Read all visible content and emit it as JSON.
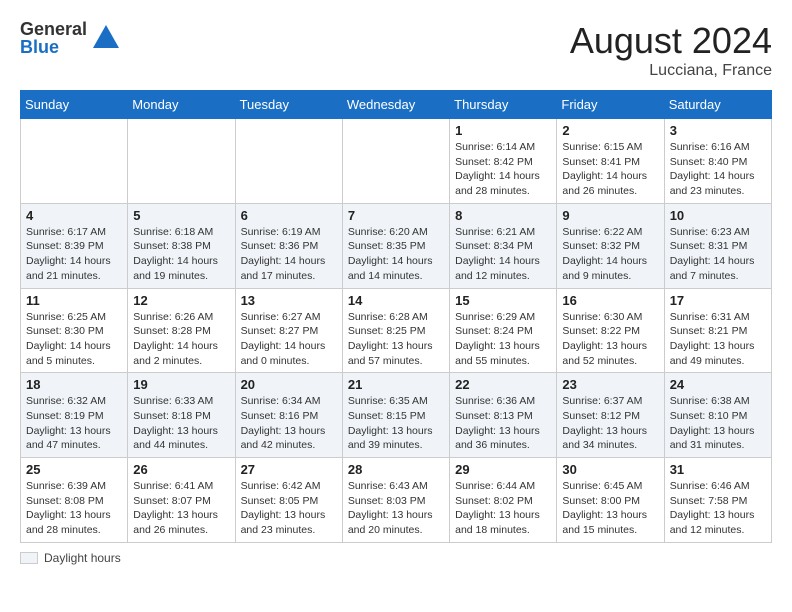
{
  "header": {
    "logo_general": "General",
    "logo_blue": "Blue",
    "month_year": "August 2024",
    "location": "Lucciana, France"
  },
  "legend": {
    "box_label": "Daylight hours"
  },
  "days_of_week": [
    "Sunday",
    "Monday",
    "Tuesday",
    "Wednesday",
    "Thursday",
    "Friday",
    "Saturday"
  ],
  "weeks": [
    [
      {
        "day": "",
        "info": ""
      },
      {
        "day": "",
        "info": ""
      },
      {
        "day": "",
        "info": ""
      },
      {
        "day": "",
        "info": ""
      },
      {
        "day": "1",
        "info": "Sunrise: 6:14 AM\nSunset: 8:42 PM\nDaylight: 14 hours and 28 minutes."
      },
      {
        "day": "2",
        "info": "Sunrise: 6:15 AM\nSunset: 8:41 PM\nDaylight: 14 hours and 26 minutes."
      },
      {
        "day": "3",
        "info": "Sunrise: 6:16 AM\nSunset: 8:40 PM\nDaylight: 14 hours and 23 minutes."
      }
    ],
    [
      {
        "day": "4",
        "info": "Sunrise: 6:17 AM\nSunset: 8:39 PM\nDaylight: 14 hours and 21 minutes."
      },
      {
        "day": "5",
        "info": "Sunrise: 6:18 AM\nSunset: 8:38 PM\nDaylight: 14 hours and 19 minutes."
      },
      {
        "day": "6",
        "info": "Sunrise: 6:19 AM\nSunset: 8:36 PM\nDaylight: 14 hours and 17 minutes."
      },
      {
        "day": "7",
        "info": "Sunrise: 6:20 AM\nSunset: 8:35 PM\nDaylight: 14 hours and 14 minutes."
      },
      {
        "day": "8",
        "info": "Sunrise: 6:21 AM\nSunset: 8:34 PM\nDaylight: 14 hours and 12 minutes."
      },
      {
        "day": "9",
        "info": "Sunrise: 6:22 AM\nSunset: 8:32 PM\nDaylight: 14 hours and 9 minutes."
      },
      {
        "day": "10",
        "info": "Sunrise: 6:23 AM\nSunset: 8:31 PM\nDaylight: 14 hours and 7 minutes."
      }
    ],
    [
      {
        "day": "11",
        "info": "Sunrise: 6:25 AM\nSunset: 8:30 PM\nDaylight: 14 hours and 5 minutes."
      },
      {
        "day": "12",
        "info": "Sunrise: 6:26 AM\nSunset: 8:28 PM\nDaylight: 14 hours and 2 minutes."
      },
      {
        "day": "13",
        "info": "Sunrise: 6:27 AM\nSunset: 8:27 PM\nDaylight: 14 hours and 0 minutes."
      },
      {
        "day": "14",
        "info": "Sunrise: 6:28 AM\nSunset: 8:25 PM\nDaylight: 13 hours and 57 minutes."
      },
      {
        "day": "15",
        "info": "Sunrise: 6:29 AM\nSunset: 8:24 PM\nDaylight: 13 hours and 55 minutes."
      },
      {
        "day": "16",
        "info": "Sunrise: 6:30 AM\nSunset: 8:22 PM\nDaylight: 13 hours and 52 minutes."
      },
      {
        "day": "17",
        "info": "Sunrise: 6:31 AM\nSunset: 8:21 PM\nDaylight: 13 hours and 49 minutes."
      }
    ],
    [
      {
        "day": "18",
        "info": "Sunrise: 6:32 AM\nSunset: 8:19 PM\nDaylight: 13 hours and 47 minutes."
      },
      {
        "day": "19",
        "info": "Sunrise: 6:33 AM\nSunset: 8:18 PM\nDaylight: 13 hours and 44 minutes."
      },
      {
        "day": "20",
        "info": "Sunrise: 6:34 AM\nSunset: 8:16 PM\nDaylight: 13 hours and 42 minutes."
      },
      {
        "day": "21",
        "info": "Sunrise: 6:35 AM\nSunset: 8:15 PM\nDaylight: 13 hours and 39 minutes."
      },
      {
        "day": "22",
        "info": "Sunrise: 6:36 AM\nSunset: 8:13 PM\nDaylight: 13 hours and 36 minutes."
      },
      {
        "day": "23",
        "info": "Sunrise: 6:37 AM\nSunset: 8:12 PM\nDaylight: 13 hours and 34 minutes."
      },
      {
        "day": "24",
        "info": "Sunrise: 6:38 AM\nSunset: 8:10 PM\nDaylight: 13 hours and 31 minutes."
      }
    ],
    [
      {
        "day": "25",
        "info": "Sunrise: 6:39 AM\nSunset: 8:08 PM\nDaylight: 13 hours and 28 minutes."
      },
      {
        "day": "26",
        "info": "Sunrise: 6:41 AM\nSunset: 8:07 PM\nDaylight: 13 hours and 26 minutes."
      },
      {
        "day": "27",
        "info": "Sunrise: 6:42 AM\nSunset: 8:05 PM\nDaylight: 13 hours and 23 minutes."
      },
      {
        "day": "28",
        "info": "Sunrise: 6:43 AM\nSunset: 8:03 PM\nDaylight: 13 hours and 20 minutes."
      },
      {
        "day": "29",
        "info": "Sunrise: 6:44 AM\nSunset: 8:02 PM\nDaylight: 13 hours and 18 minutes."
      },
      {
        "day": "30",
        "info": "Sunrise: 6:45 AM\nSunset: 8:00 PM\nDaylight: 13 hours and 15 minutes."
      },
      {
        "day": "31",
        "info": "Sunrise: 6:46 AM\nSunset: 7:58 PM\nDaylight: 13 hours and 12 minutes."
      }
    ]
  ]
}
